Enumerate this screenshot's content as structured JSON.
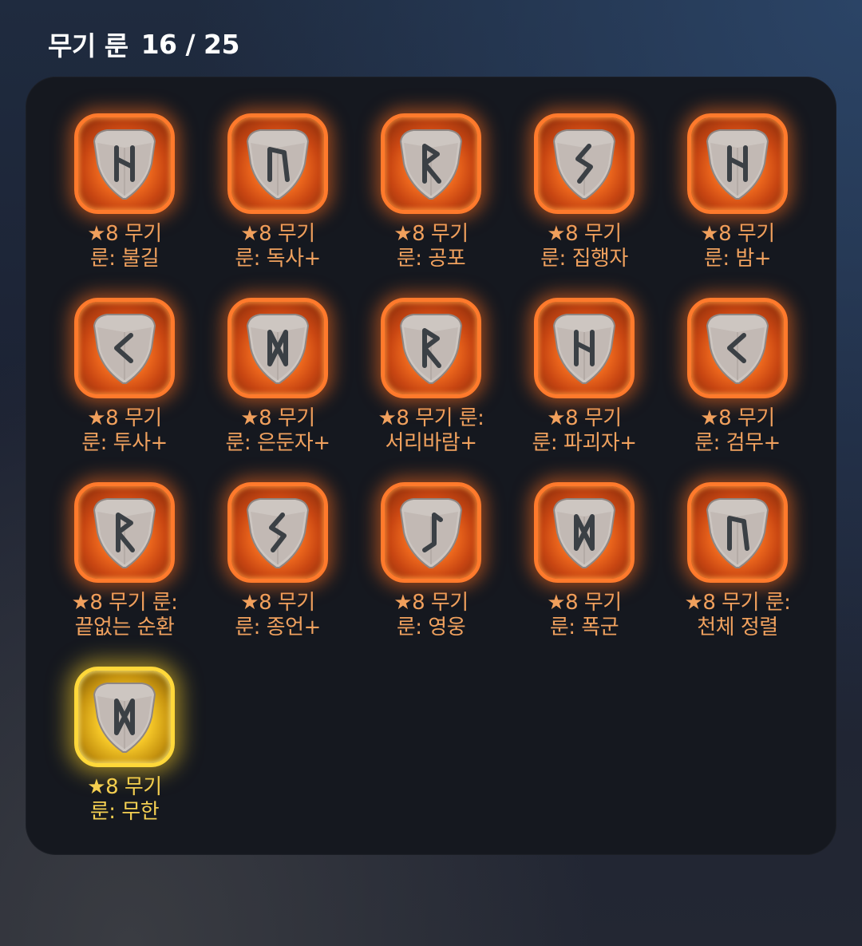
{
  "header": {
    "title": "무기 룬",
    "count": "16 / 25"
  },
  "colors": {
    "legendary_border": "#ff7a2c",
    "legendary_text": "#f0a15e",
    "mythic_border": "#ffd83a",
    "mythic_text": "#f4cf52",
    "panel_bg": "#15181f"
  },
  "runes": [
    {
      "line1": "★8 무기",
      "line2": "룬: 불길",
      "glyph": "hagalaz-icon",
      "tier": "legendary"
    },
    {
      "line1": "★8 무기",
      "line2": "룬: 독사+",
      "glyph": "uruz-icon",
      "tier": "legendary"
    },
    {
      "line1": "★8 무기",
      "line2": "룬: 공포",
      "glyph": "raido-icon",
      "tier": "legendary"
    },
    {
      "line1": "★8 무기",
      "line2": "룬: 집행자",
      "glyph": "sowilo-icon",
      "tier": "legendary"
    },
    {
      "line1": "★8 무기",
      "line2": "룬: 밤+",
      "glyph": "hagalaz-icon",
      "tier": "legendary"
    },
    {
      "line1": "★8 무기",
      "line2": "룬: 투사+",
      "glyph": "kenaz-icon",
      "tier": "legendary"
    },
    {
      "line1": "★8 무기",
      "line2": "룬: 은둔자+",
      "glyph": "dagaz-icon",
      "tier": "legendary"
    },
    {
      "line1": "★8 무기 룬:",
      "line2": "서리바람+",
      "glyph": "raido-icon",
      "tier": "legendary"
    },
    {
      "line1": "★8 무기",
      "line2": "룬: 파괴자+",
      "glyph": "hagalaz-icon",
      "tier": "legendary"
    },
    {
      "line1": "★8 무기",
      "line2": "룬: 검무+",
      "glyph": "kenaz-icon",
      "tier": "legendary"
    },
    {
      "line1": "★8 무기 룬:",
      "line2": "끝없는 순환",
      "glyph": "raido-icon",
      "tier": "legendary"
    },
    {
      "line1": "★8 무기",
      "line2": "룬: 종언+",
      "glyph": "sowilo-icon",
      "tier": "legendary"
    },
    {
      "line1": "★8 무기",
      "line2": "룬: 영웅",
      "glyph": "laguz-icon",
      "tier": "legendary"
    },
    {
      "line1": "★8 무기",
      "line2": "룬: 폭군",
      "glyph": "dagaz-icon",
      "tier": "legendary"
    },
    {
      "line1": "★8 무기 룬:",
      "line2": "천체 정렬",
      "glyph": "uruz-icon",
      "tier": "legendary"
    },
    {
      "line1": "★8 무기",
      "line2": "룬: 무한",
      "glyph": "dagaz-icon",
      "tier": "mythic"
    }
  ]
}
